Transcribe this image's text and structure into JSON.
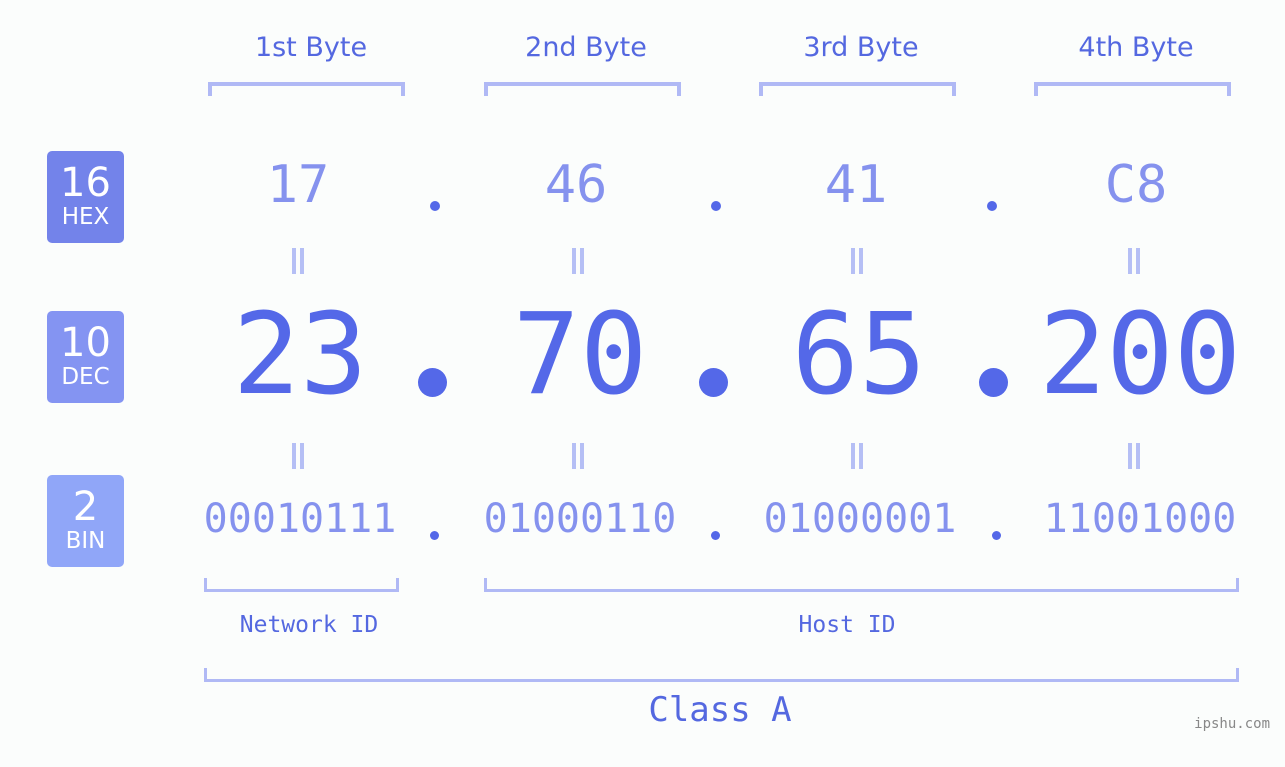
{
  "bytes": {
    "headers": [
      "1st Byte",
      "2nd Byte",
      "3rd Byte",
      "4th Byte"
    ]
  },
  "badges": [
    {
      "base": "16",
      "label": "HEX",
      "color": "#7383ea"
    },
    {
      "base": "10",
      "label": "DEC",
      "color": "#8494f2"
    },
    {
      "base": "2",
      "label": "BIN",
      "color": "#90a6f8"
    }
  ],
  "ip": {
    "hex": [
      "17",
      "46",
      "41",
      "C8"
    ],
    "dec": [
      "23",
      "70",
      "65",
      "200"
    ],
    "bin": [
      "00010111",
      "01000110",
      "01000001",
      "11001000"
    ],
    "separator": "."
  },
  "segments": {
    "network_label": "Network ID",
    "host_label": "Host ID",
    "network_bytes": 1,
    "host_bytes": 3
  },
  "ip_class": "Class A",
  "watermark": "ipshu.com",
  "colors": {
    "accent": "#5468e8",
    "light_accent": "#8592ee",
    "bracket": "#b0b9f5",
    "background": "#fbfdfc"
  }
}
